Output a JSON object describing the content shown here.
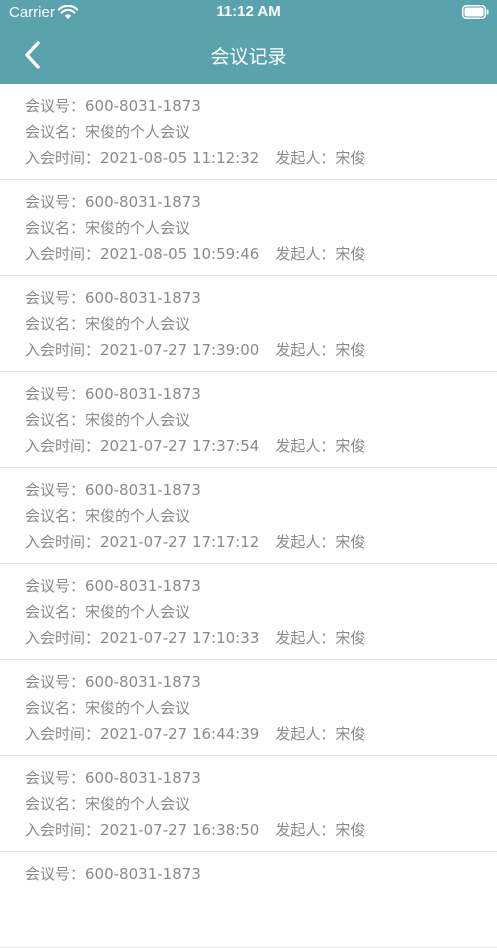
{
  "status_bar": {
    "carrier": "Carrier",
    "time": "11:12 AM"
  },
  "nav": {
    "title": "会议记录",
    "back_icon": "chevron-left-icon"
  },
  "labels": {
    "meeting_no": "会议号：",
    "meeting_name": "会议名：",
    "join_time": "入会时间：",
    "initiator": "发起人："
  },
  "colors": {
    "header": "#5aa3ac",
    "text": "#8a8a8a",
    "divider": "#e6e6e6"
  },
  "records": [
    {
      "meeting_no": "600-8031-1873",
      "meeting_name": "宋俊的个人会议",
      "join_time": "2021-08-05 11:12:32",
      "initiator": "宋俊"
    },
    {
      "meeting_no": "600-8031-1873",
      "meeting_name": "宋俊的个人会议",
      "join_time": "2021-08-05 10:59:46",
      "initiator": "宋俊"
    },
    {
      "meeting_no": "600-8031-1873",
      "meeting_name": "宋俊的个人会议",
      "join_time": "2021-07-27 17:39:00",
      "initiator": "宋俊"
    },
    {
      "meeting_no": "600-8031-1873",
      "meeting_name": "宋俊的个人会议",
      "join_time": "2021-07-27 17:37:54",
      "initiator": "宋俊"
    },
    {
      "meeting_no": "600-8031-1873",
      "meeting_name": "宋俊的个人会议",
      "join_time": "2021-07-27 17:17:12",
      "initiator": "宋俊"
    },
    {
      "meeting_no": "600-8031-1873",
      "meeting_name": "宋俊的个人会议",
      "join_time": "2021-07-27 17:10:33",
      "initiator": "宋俊"
    },
    {
      "meeting_no": "600-8031-1873",
      "meeting_name": "宋俊的个人会议",
      "join_time": "2021-07-27 16:44:39",
      "initiator": "宋俊"
    },
    {
      "meeting_no": "600-8031-1873",
      "meeting_name": "宋俊的个人会议",
      "join_time": "2021-07-27 16:38:50",
      "initiator": "宋俊"
    },
    {
      "meeting_no": "600-8031-1873"
    }
  ]
}
